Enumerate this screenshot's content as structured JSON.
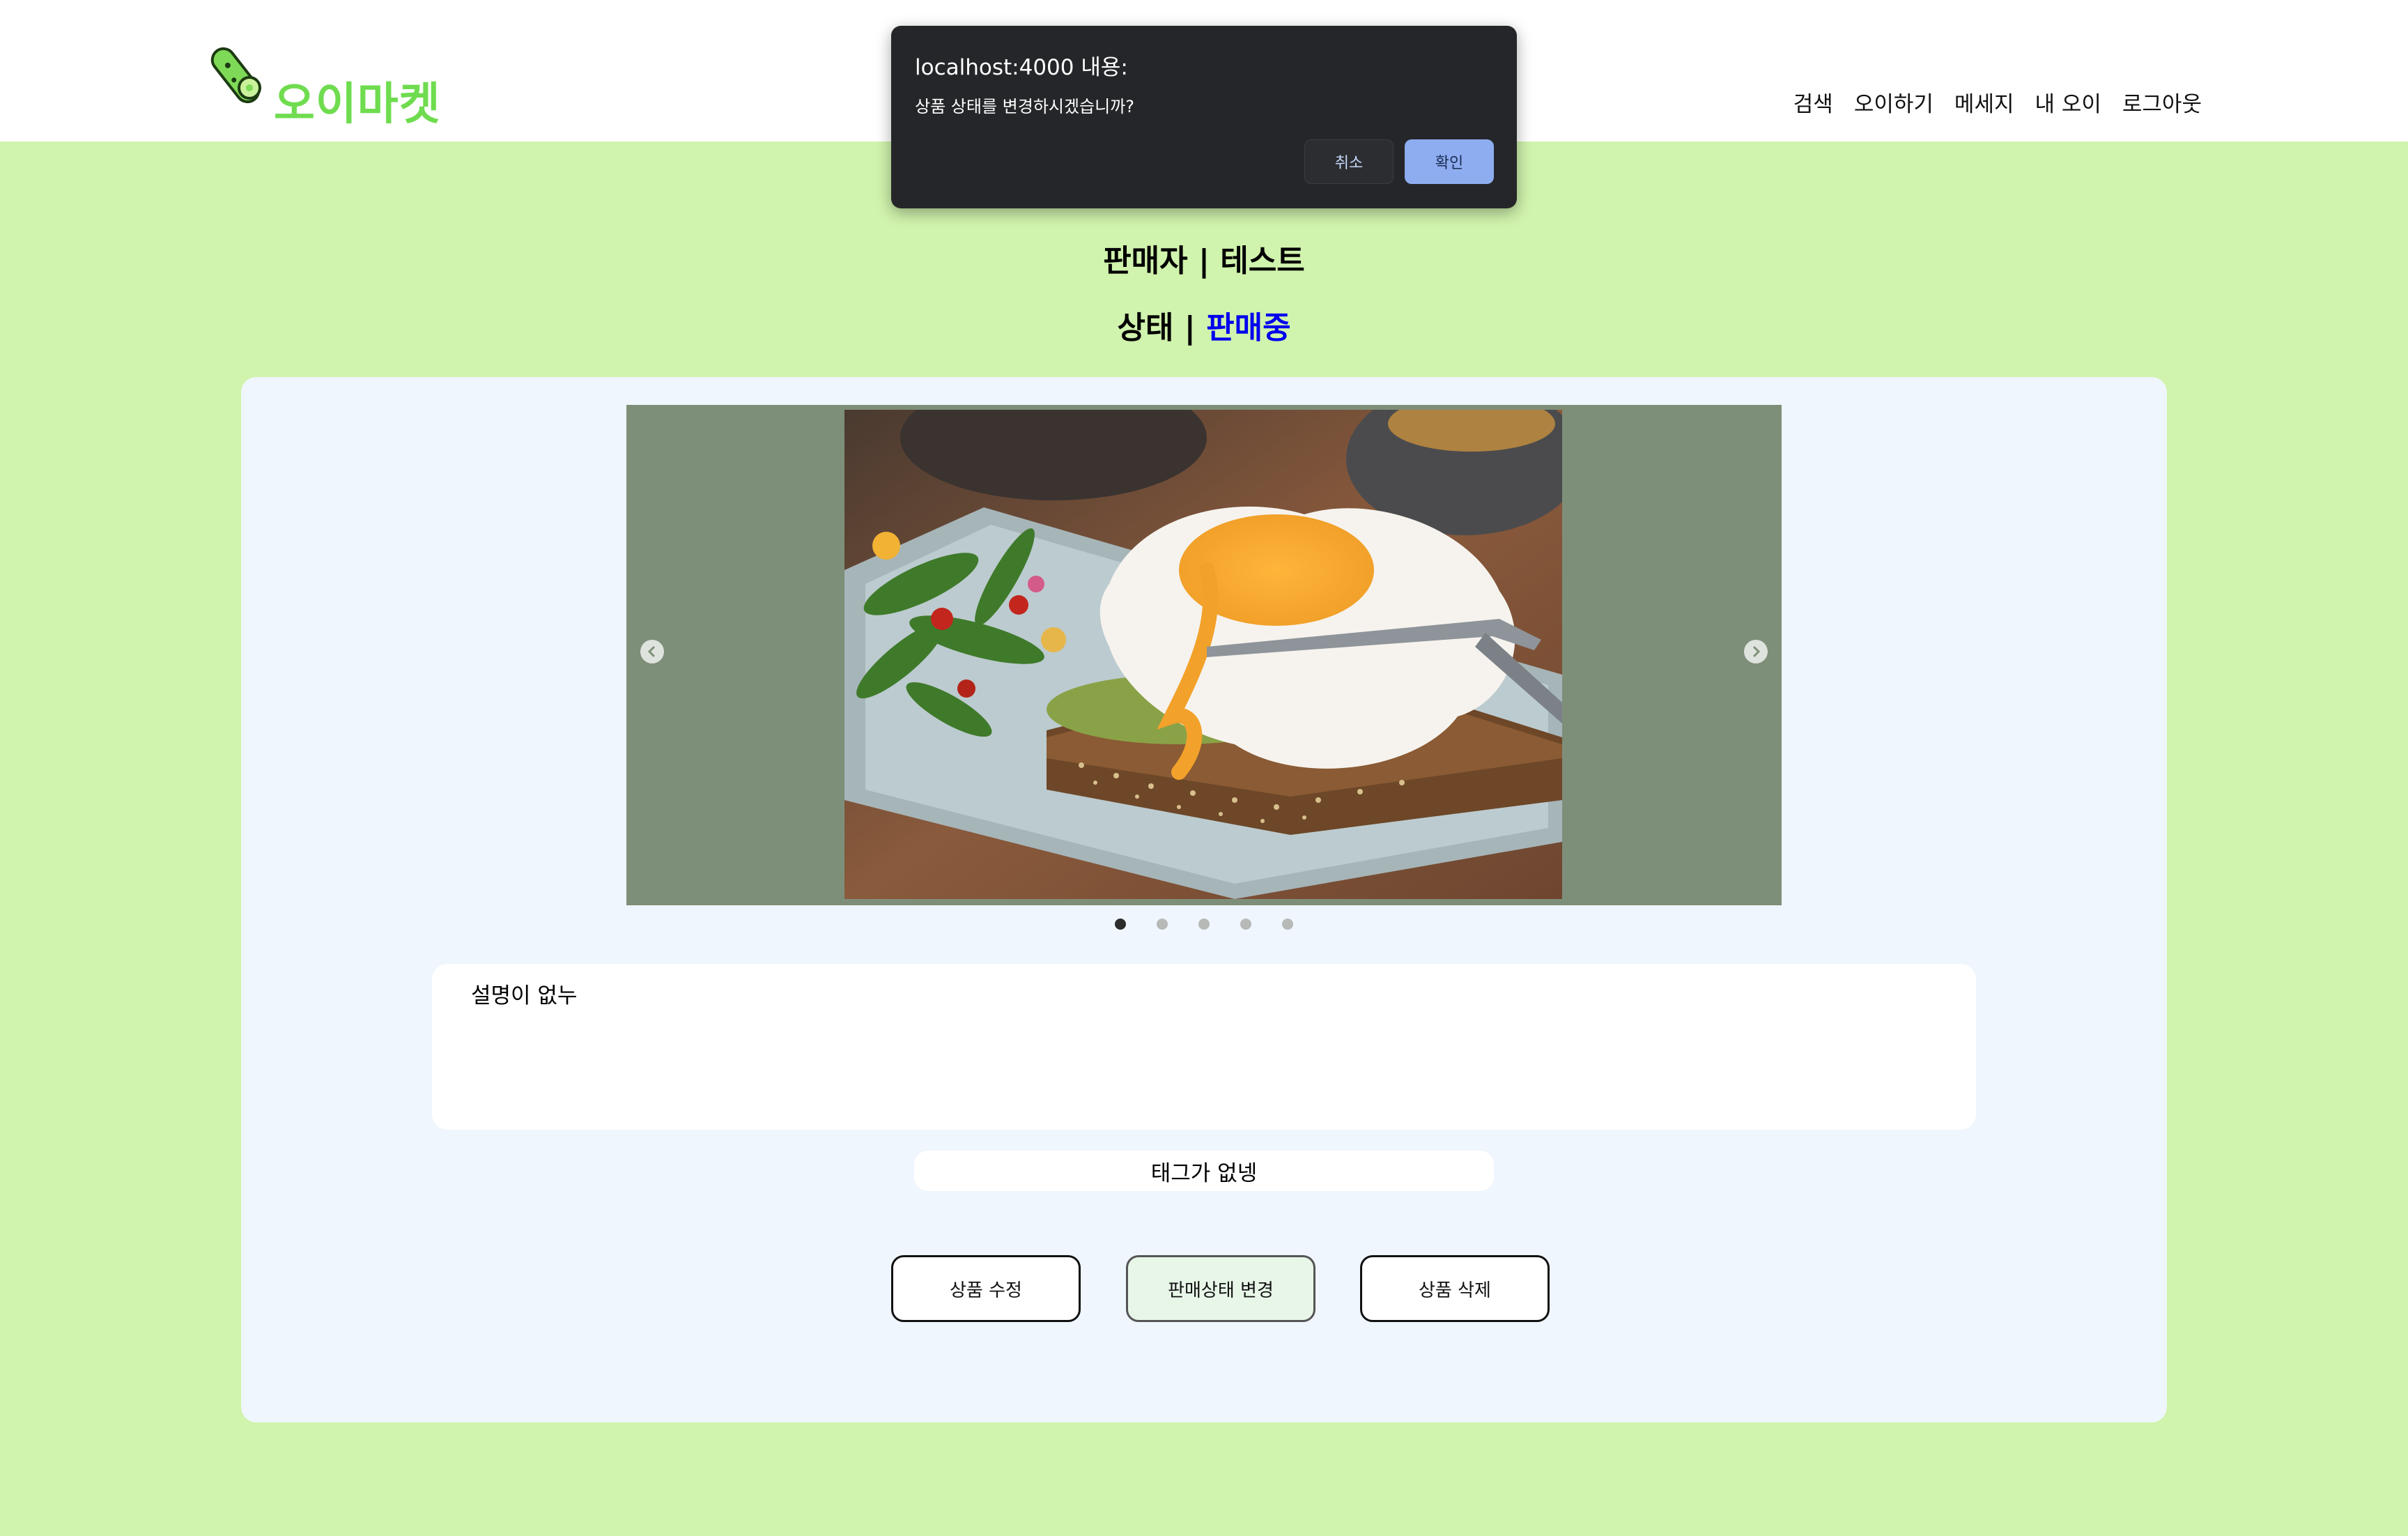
{
  "header": {
    "logo_text": "오이마켓",
    "nav": [
      "검색",
      "오이하기",
      "메세지",
      "내 오이",
      "로그아웃"
    ]
  },
  "product": {
    "seller_line": "판매자 | 테스트",
    "status_label": "상태 | ",
    "status_value": "판매중",
    "carousel": {
      "slide_count": 5,
      "active_index": 0
    },
    "description": "설명이 없누",
    "tags": "태그가 없넹",
    "buttons": {
      "edit": "상품 수정",
      "change_status": "판매상태 변경",
      "delete": "상품 삭제"
    }
  },
  "dialog": {
    "title": "localhost:4000 내용:",
    "message": "상품 상태를 변경하시겠습니까?",
    "cancel": "취소",
    "ok": "확인"
  },
  "colors": {
    "page_bg": "#d0f3ad",
    "logo_green": "#6fdc4f",
    "status_blue": "#0000ee",
    "card_bg": "#eff6fd",
    "carousel_bg": "#7e8f79",
    "dialog_bg": "#252629",
    "dialog_ok": "#8eadf0"
  },
  "icons": [
    "cucumber-logo-icon",
    "chevron-left-icon",
    "chevron-right-icon"
  ]
}
